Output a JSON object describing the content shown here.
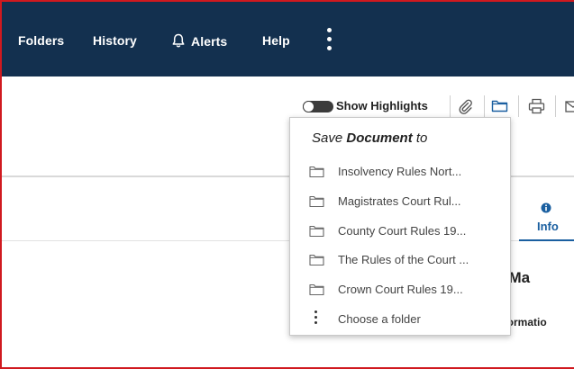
{
  "nav": {
    "items": [
      {
        "label": "Folders"
      },
      {
        "label": "History"
      },
      {
        "label": "Alerts",
        "icon": "bell-icon"
      },
      {
        "label": "Help"
      }
    ],
    "more_icon": "kebab-vertical-icon"
  },
  "toolbar": {
    "show_highlights_label": "Show Highlights",
    "toggle_on": false,
    "icons": [
      "attachment-icon",
      "folder-icon",
      "print-icon",
      "email-icon"
    ]
  },
  "tabs": {
    "info_label": "Info",
    "info_icon": "info-icon"
  },
  "content": {
    "heading_partial": "rting Ma",
    "source_info_partial": "Source Informatio"
  },
  "save_menu": {
    "title_prefix": "Save",
    "title_bold": "Document",
    "title_suffix": "to",
    "folders": [
      {
        "label": "Insolvency Rules Nort..."
      },
      {
        "label": "Magistrates Court Rul..."
      },
      {
        "label": "County Court Rules 19..."
      },
      {
        "label": "The Rules of the Court ..."
      },
      {
        "label": "Crown Court Rules 19..."
      }
    ],
    "choose_label": "Choose a folder"
  },
  "colors": {
    "nav_bg": "#13304f",
    "accent": "#1a5fa0",
    "frame_border": "#d0191f"
  }
}
